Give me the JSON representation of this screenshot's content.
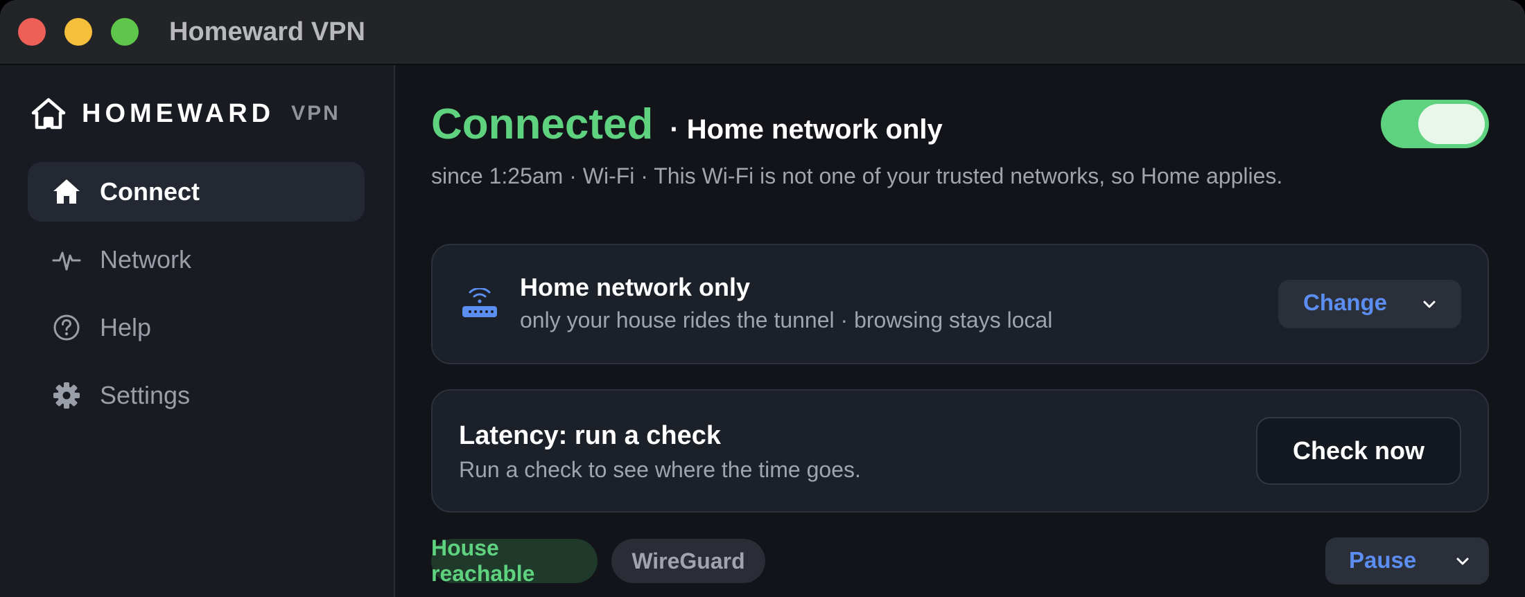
{
  "window": {
    "title": "Homeward VPN"
  },
  "brand": {
    "name": "HOMEWARD",
    "suffix": "VPN"
  },
  "sidebar": {
    "items": [
      {
        "label": "Connect",
        "icon": "home-icon",
        "active": true
      },
      {
        "label": "Network",
        "icon": "activity-icon",
        "active": false
      },
      {
        "label": "Help",
        "icon": "help-icon",
        "active": false
      },
      {
        "label": "Settings",
        "icon": "gear-icon",
        "active": false
      }
    ]
  },
  "status": {
    "state": "Connected",
    "mode_suffix": "· Home network only",
    "toggle_on": true,
    "description": "since 1:25am · Wi-Fi · This Wi-Fi is not one of your trusted networks, so Home applies."
  },
  "mode_card": {
    "icon": "router-icon",
    "title": "Home network only",
    "subtitle": "only your house rides the tunnel · browsing stays local",
    "change_label": "Change"
  },
  "latency_card": {
    "title": "Latency: run a check",
    "subtitle": "Run a check to see where the time goes.",
    "button_label": "Check now"
  },
  "footer": {
    "chips": [
      {
        "label": "House reachable"
      },
      {
        "label": "WireGuard"
      }
    ],
    "pause_label": "Pause"
  },
  "colors": {
    "accent_green": "#5fd27f",
    "accent_blue": "#5b8ef0",
    "background": "#12141a",
    "sidebar": "#181b22",
    "card": "#1c2029"
  }
}
